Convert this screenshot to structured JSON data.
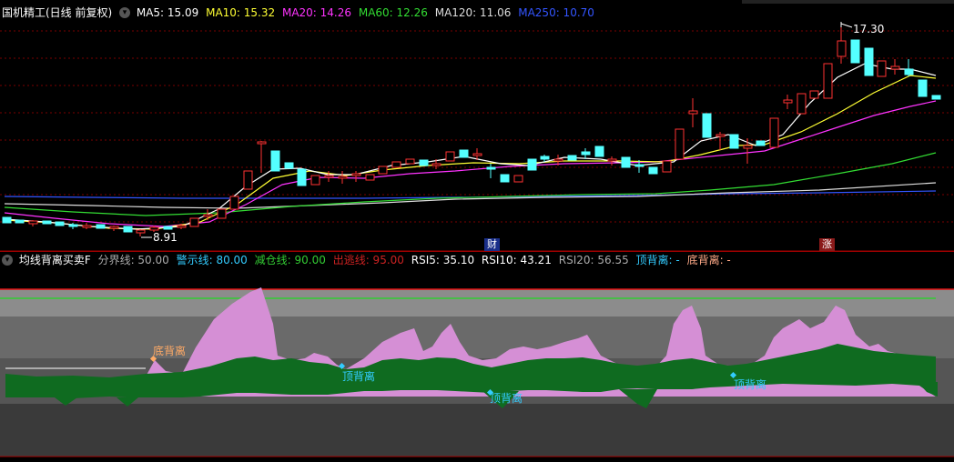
{
  "main": {
    "title": "国机精工(日线 前复权)",
    "ma_labels": [
      {
        "text": "MA5: 15.09",
        "color": "#ffffff"
      },
      {
        "text": "MA10: 15.32",
        "color": "#ffff33"
      },
      {
        "text": "MA20: 14.26",
        "color": "#ff33ff"
      },
      {
        "text": "MA60: 12.26",
        "color": "#33dd33"
      },
      {
        "text": "MA120: 11.06",
        "color": "#dddddd"
      },
      {
        "text": "MA250: 10.70",
        "color": "#3355ff"
      }
    ],
    "high_label": "17.30",
    "low_label": "8.91",
    "event_cai": "财",
    "event_zhang": "涨"
  },
  "indicator": {
    "title": "均线背离买卖F",
    "params": [
      {
        "text": "分界线: 50.00",
        "color": "#aaaaaa"
      },
      {
        "text": "警示线: 80.00",
        "color": "#33ccff"
      },
      {
        "text": "减仓线: 90.00",
        "color": "#33cc33"
      },
      {
        "text": "出逃线: 95.00",
        "color": "#cc2222"
      },
      {
        "text": "RSI5: 35.10",
        "color": "#ffffff"
      },
      {
        "text": "RSI10: 43.21",
        "color": "#ffffff"
      },
      {
        "text": "RSI20: 56.55",
        "color": "#aaaaaa"
      },
      {
        "text": "顶背离: -",
        "color": "#33ccff"
      },
      {
        "text": "底背离: -",
        "color": "#ffaa88"
      }
    ],
    "markers": {
      "bottom_div_1": "底背离",
      "top_div_1": "顶背离",
      "top_div_2": "顶背离",
      "top_div_3": "顶背离"
    }
  },
  "colors": {
    "up": "#ff3232",
    "down": "#54ffff",
    "ma5": "#ffffff",
    "ma10": "#ffff33",
    "ma20": "#ff33ff",
    "ma60": "#33dd33",
    "ma120": "#dddddd",
    "ma250": "#3355ff",
    "purple_area": "#d58fd5",
    "green_area": "#0f6b20"
  }
}
